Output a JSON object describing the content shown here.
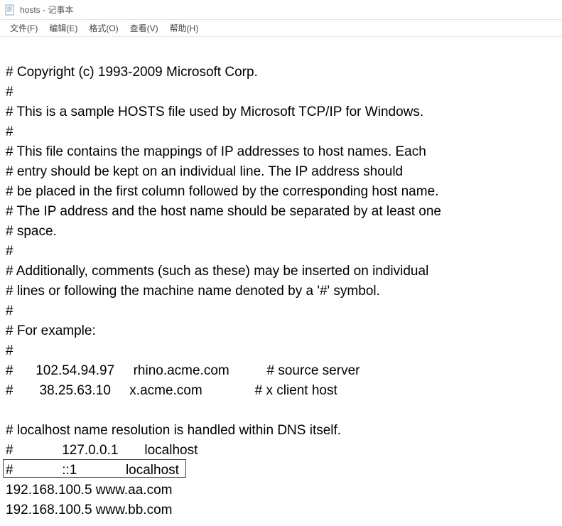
{
  "window": {
    "title": "hosts - 记事本"
  },
  "menu": {
    "file": "文件(F)",
    "edit": "编辑(E)",
    "format": "格式(O)",
    "view": "查看(V)",
    "help": "帮助(H)"
  },
  "content": {
    "lines": [
      "# Copyright (c) 1993-2009 Microsoft Corp.",
      "#",
      "# This is a sample HOSTS file used by Microsoft TCP/IP for Windows.",
      "#",
      "# This file contains the mappings of IP addresses to host names. Each",
      "# entry should be kept on an individual line. The IP address should",
      "# be placed in the first column followed by the corresponding host name.",
      "# The IP address and the host name should be separated by at least one",
      "# space.",
      "#",
      "# Additionally, comments (such as these) may be inserted on individual",
      "# lines or following the machine name denoted by a '#' symbol.",
      "#",
      "# For example:",
      "#",
      "#      102.54.94.97     rhino.acme.com          # source server",
      "#       38.25.63.10     x.acme.com              # x client host",
      "",
      "# localhost name resolution is handled within DNS itself.",
      "#             127.0.0.1       localhost",
      "#             ::1             localhost",
      "192.168.100.5 www.aa.com",
      "192.168.100.5 www.bb.com"
    ]
  },
  "highlight": {
    "line_index": 21
  }
}
